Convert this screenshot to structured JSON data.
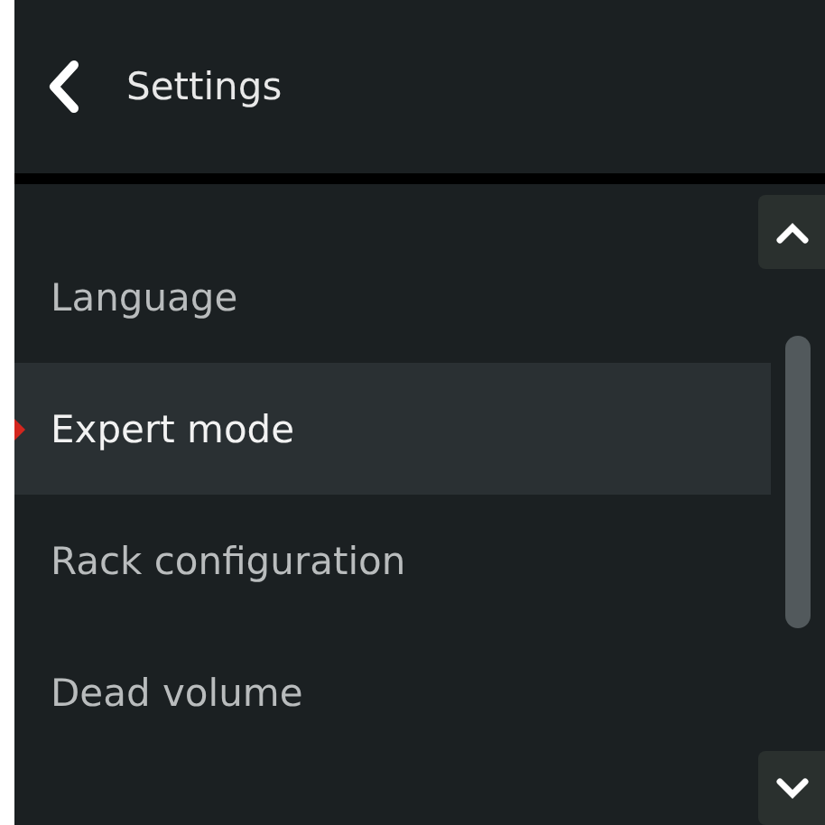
{
  "header": {
    "title": "Settings"
  },
  "menu": {
    "items": [
      {
        "label": "Language",
        "selected": false
      },
      {
        "label": "Expert mode",
        "selected": true
      },
      {
        "label": "Rack configuration",
        "selected": false
      },
      {
        "label": "Dead volume",
        "selected": false
      }
    ]
  }
}
